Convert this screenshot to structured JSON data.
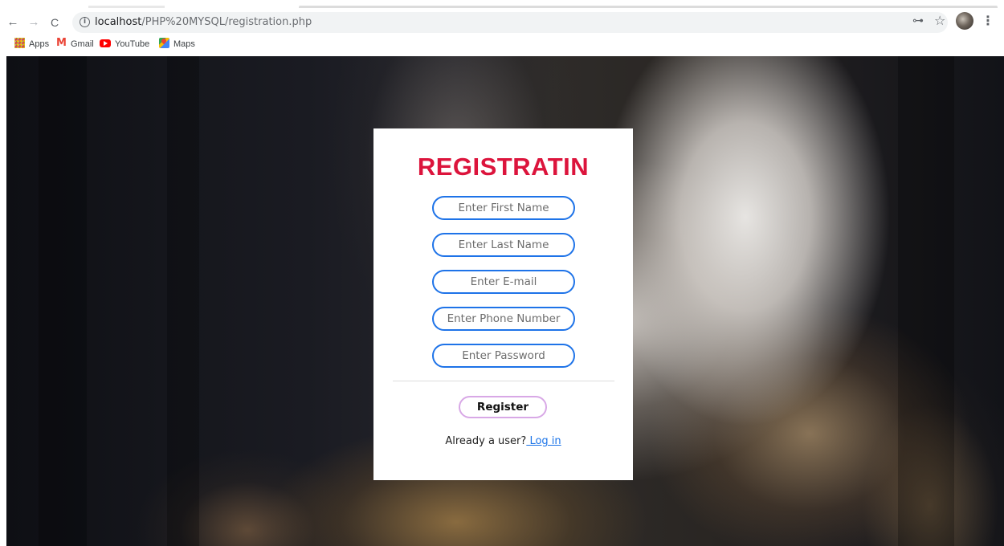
{
  "browser": {
    "url_host": "localhost",
    "url_path": "/PHP%20MYSQL/registration.php",
    "bookmarks": [
      {
        "label": "Apps",
        "icon": "apps-grid-icon"
      },
      {
        "label": "Gmail",
        "icon": "gmail-icon"
      },
      {
        "label": "YouTube",
        "icon": "youtube-icon"
      },
      {
        "label": "Maps",
        "icon": "maps-icon"
      }
    ],
    "icons": {
      "back": "←",
      "forward": "→",
      "reload": "C",
      "info": "i",
      "key": "⊶",
      "star": "☆",
      "menu": "⋮"
    }
  },
  "form": {
    "title": "REGISTRATIN",
    "title_color": "#dc143c",
    "field_border_color": "#1e73e8",
    "fields": [
      {
        "placeholder": "Enter First Name",
        "value": ""
      },
      {
        "placeholder": "Enter Last Name",
        "value": ""
      },
      {
        "placeholder": "Enter E-mail",
        "value": ""
      },
      {
        "placeholder": "Enter Phone Number",
        "value": ""
      },
      {
        "placeholder": "Enter Password",
        "value": ""
      }
    ],
    "register_label": "Register",
    "login_prompt": "Already a user?",
    "login_link": " Log in"
  }
}
